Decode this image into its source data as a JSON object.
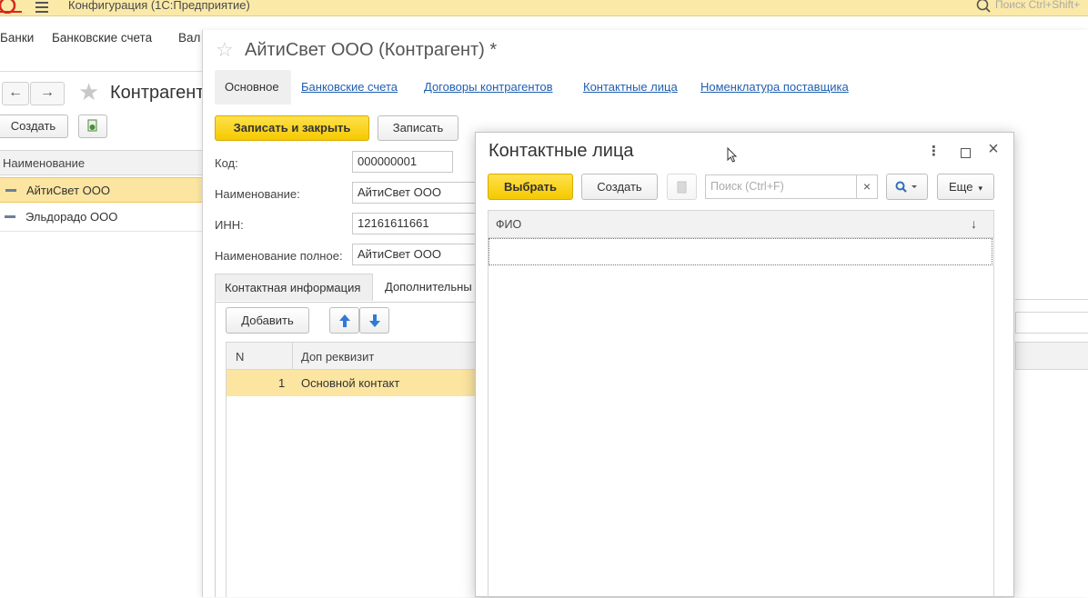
{
  "app": {
    "title": "Конфигурация (1С:Предприятие)",
    "search_placeholder": "Поиск Ctrl+Shift+"
  },
  "sections": [
    "Банки",
    "Банковские счета",
    "Вал"
  ],
  "list_form": {
    "title": "Контрагент",
    "create_label": "Создать",
    "column_name": "Наименование",
    "rows": [
      "АйтиСвет ООО",
      "Эльдорадо ООО"
    ]
  },
  "cp_form": {
    "title": "АйтиСвет ООО (Контрагент) *",
    "tabs": {
      "main": "Основное",
      "bank_accounts": "Банковские счета",
      "contracts": "Договоры контрагентов",
      "contacts": "Контактные лица",
      "supplier_items": "Номенклатура поставщика"
    },
    "save_close_label": "Записать и закрыть",
    "save_label": "Записать",
    "fields": {
      "code_label": "Код:",
      "code_value": "000000001",
      "name_label": "Наименование:",
      "name_value": "АйтиСвет ООО",
      "inn_label": "ИНН:",
      "inn_value": "12161611661",
      "fullname_label": "Наименование полное:",
      "fullname_value": "АйтиСвет ООО"
    },
    "subtabs": {
      "contact_info": "Контактная информация",
      "additional": "Дополнительны"
    },
    "add_label": "Добавить",
    "table": {
      "col_n": "N",
      "col_attr": "Доп реквизит",
      "rows": [
        {
          "n": "1",
          "attr": "Основной контакт"
        }
      ]
    }
  },
  "dialog": {
    "title": "Контактные лица",
    "choose_label": "Выбрать",
    "create_label": "Создать",
    "search_placeholder": "Поиск (Ctrl+F)",
    "clear_glyph": "×",
    "more_label": "Еще",
    "column_fio": "ФИО",
    "sort_glyph": "↓"
  },
  "colors": {
    "accent_yellow": "#f5c900",
    "link_blue": "#1f5fb0",
    "selected_row": "#fbe5a1",
    "topbar": "#fbe9a8"
  }
}
